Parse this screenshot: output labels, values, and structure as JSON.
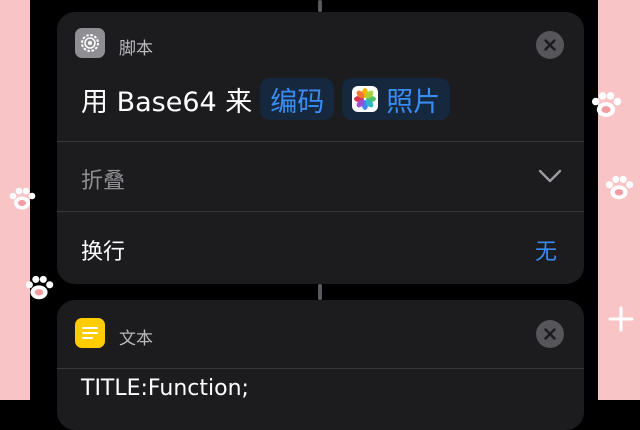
{
  "action_card": {
    "icon": "gear-icon",
    "title": "脚本",
    "prefix": "用 Base64 来",
    "mode_pill": "编码",
    "input_pill_icon": "photos-icon",
    "input_pill": "照片",
    "collapse_row": {
      "label": "折叠"
    },
    "wrap_row": {
      "label": "换行",
      "value": "无"
    }
  },
  "text_card": {
    "icon": "note-icon",
    "title": "文本",
    "content": "TITLE:Function;"
  },
  "colors": {
    "accent": "#3a8cf5",
    "card_bg": "#1c1c1e",
    "wallpaper": "#f8c4c6"
  }
}
